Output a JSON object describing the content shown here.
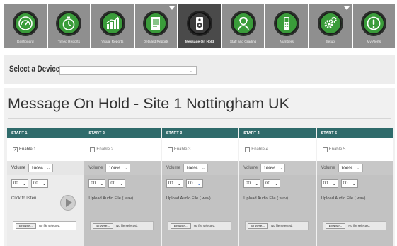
{
  "nav": {
    "items": [
      {
        "label": "Dashboard",
        "icon": "gauge-icon",
        "dropdown": false,
        "active": false
      },
      {
        "label": "Timed Reports",
        "icon": "stopwatch-icon",
        "dropdown": false,
        "active": false
      },
      {
        "label": "Visual Reports",
        "icon": "bar-chart-icon",
        "dropdown": false,
        "active": false
      },
      {
        "label": "Detailed Reports",
        "icon": "document-icon",
        "dropdown": true,
        "active": false
      },
      {
        "label": "Message On Hold",
        "icon": "speaker-icon",
        "dropdown": false,
        "active": true
      },
      {
        "label": "Staff and Grading",
        "icon": "user-headset-icon",
        "dropdown": false,
        "active": false
      },
      {
        "label": "Numbers",
        "icon": "phone-icon",
        "dropdown": false,
        "active": false
      },
      {
        "label": "Setup",
        "icon": "gears-icon",
        "dropdown": true,
        "active": false
      },
      {
        "label": "My Alerts",
        "icon": "alert-icon",
        "dropdown": false,
        "active": false
      }
    ],
    "accent_color": "#3a9c3a"
  },
  "device": {
    "label": "Select a Device",
    "value": ""
  },
  "page": {
    "title": "Message On Hold - Site 1 Nottingham UK"
  },
  "starts": [
    {
      "header": "START 1",
      "enable_label": "Enable 1",
      "enabled": true,
      "volume_label": "Volume",
      "volume_value": "100%",
      "hour": "00",
      "minute": "00",
      "listen_label": "Click to listen",
      "browse_label": "Browse...",
      "file_status": "No file selected."
    },
    {
      "header": "START 2",
      "enable_label": "Enable 2",
      "enabled": false,
      "volume_label": "Volume",
      "volume_value": "100%",
      "hour": "00",
      "minute": "00",
      "upload_label": "Upload Audio File (.wav)",
      "browse_label": "Browse...",
      "file_status": "No file selected."
    },
    {
      "header": "START 3",
      "enable_label": "Enable 3",
      "enabled": false,
      "volume_label": "Volume",
      "volume_value": "100%",
      "hour": "00",
      "minute": "00",
      "upload_label": "Upload Audio File (.wav)",
      "browse_label": "Browse...",
      "file_status": "No file selected."
    },
    {
      "header": "START 4",
      "enable_label": "Enable 4",
      "enabled": false,
      "volume_label": "Volume",
      "volume_value": "100%",
      "hour": "00",
      "minute": "00",
      "upload_label": "Upload Audio File (.wav)",
      "browse_label": "Browse...",
      "file_status": "No file selected."
    },
    {
      "header": "START 5",
      "enable_label": "Enable 5",
      "enabled": false,
      "volume_label": "Volume",
      "volume_value": "100%",
      "hour": "00",
      "minute": "00",
      "upload_label": "Upload Audio File (.wav)",
      "browse_label": "Browse...",
      "file_status": "No file selected."
    }
  ],
  "colors": {
    "header_teal": "#2f6b6b",
    "nav_gray": "#8f8f8f",
    "nav_active": "#4a4a4a"
  }
}
